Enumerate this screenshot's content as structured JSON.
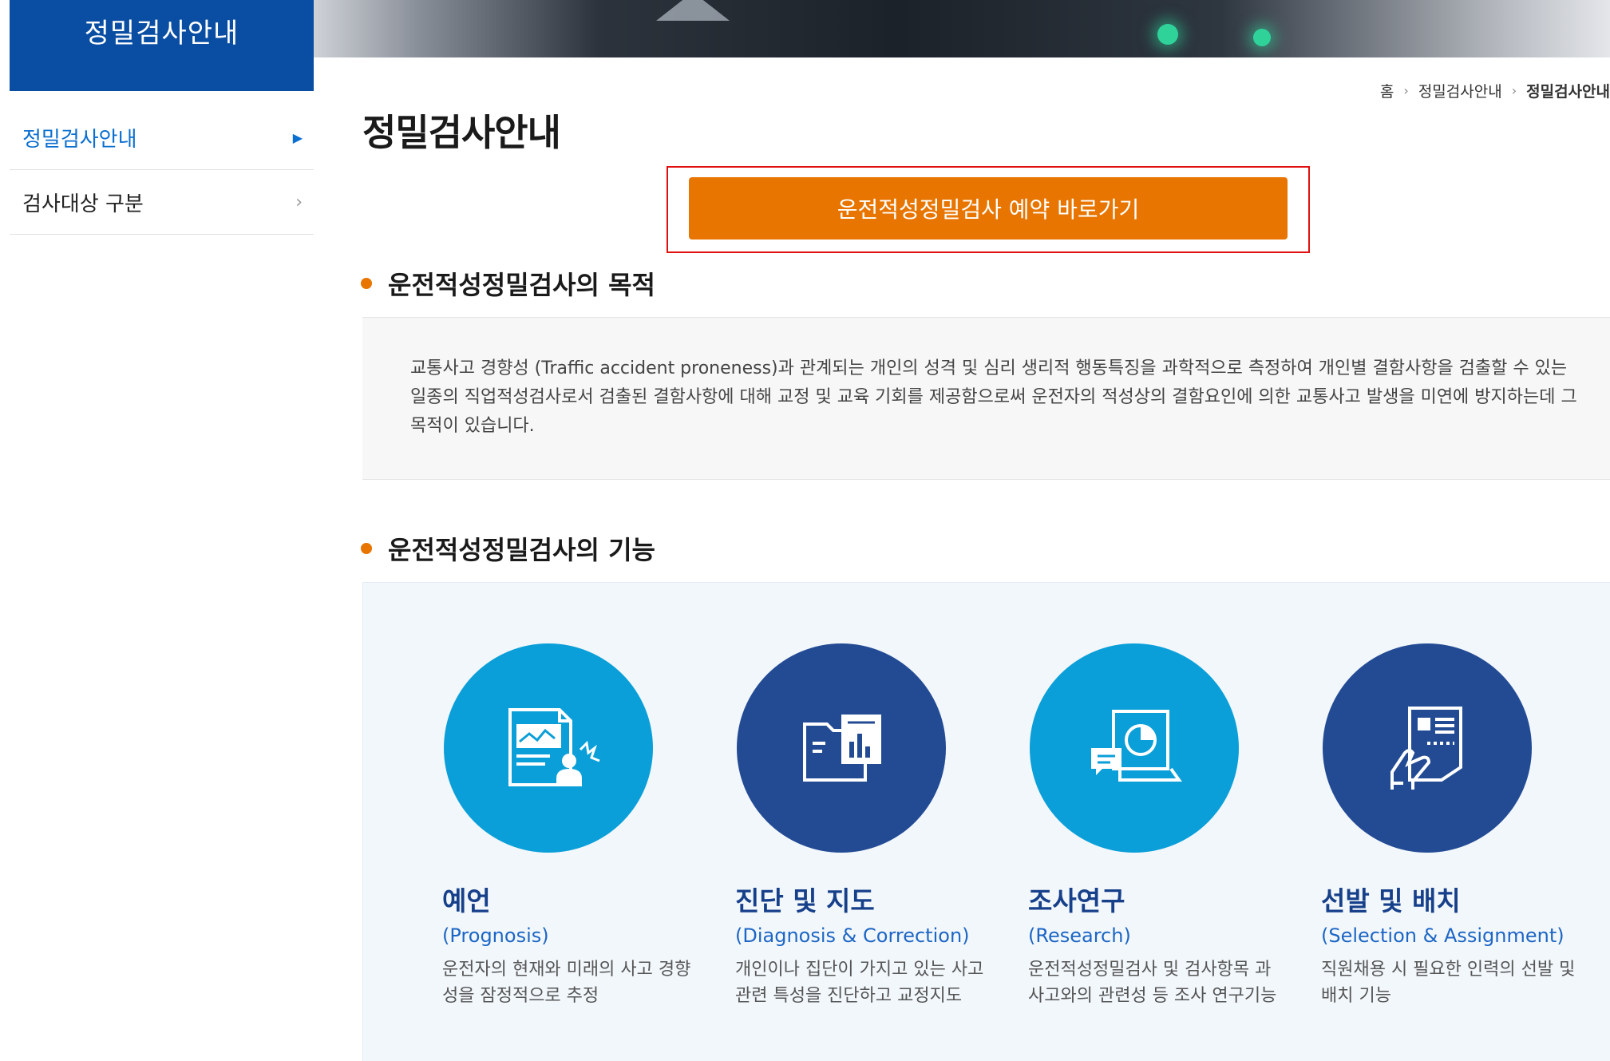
{
  "sidebar": {
    "title": "정밀검사안내",
    "items": [
      {
        "label": "정밀검사안내",
        "active": true
      },
      {
        "label": "검사대상 구분",
        "active": false
      }
    ]
  },
  "breadcrumb": {
    "home": "홈",
    "level1": "정밀검사안내",
    "current": "정밀검사안내"
  },
  "page": {
    "title": "정밀검사안내"
  },
  "cta": {
    "label": "운전적성정밀검사 예약 바로가기"
  },
  "purpose": {
    "title": "운전적성정밀검사의 목적",
    "text": "교통사고 경향성 (Traffic accident proneness)과 관계되는 개인의 성격 및 심리 생리적 행동특징을 과학적으로 측정하여 개인별 결함사항을 검출할 수 있는 일종의 직업적성검사로서 검출된 결함사항에 대해 교정 및 교육 기회를 제공함으로써 운전자의 적성상의 결함요인에 의한 교통사고 발생을 미연에 방지하는데 그 목적이 있습니다."
  },
  "functions": {
    "title": "운전적성정밀검사의 기능",
    "items": [
      {
        "name": "예언",
        "eng": "(Prognosis)",
        "desc": "운전자의 현재와 미래의 사고 경향성을 잠정적으로 추정",
        "icon": "report-person-icon"
      },
      {
        "name": "진단 및 지도",
        "eng": "(Diagnosis & Correction)",
        "desc": "개인이나 집단이 가지고 있는 사고관련 특성을 진단하고 교정지도",
        "icon": "folder-chart-icon"
      },
      {
        "name": "조사연구",
        "eng": "(Research)",
        "desc": "운전적성정밀검사 및 검사항목 과 사고와의 관련성 등 조사 연구기능",
        "icon": "document-pie-chat-icon"
      },
      {
        "name": "선발 및 배치",
        "eng": "(Selection & Assignment)",
        "desc": "직원채용 시 필요한 인력의 선발 및 배치 기능",
        "icon": "hand-resume-icon"
      }
    ]
  },
  "colors": {
    "brand_blue": "#0a4ea3",
    "accent_orange": "#e77500",
    "circle_light": "#0a9fd8",
    "circle_dark": "#234b94"
  }
}
